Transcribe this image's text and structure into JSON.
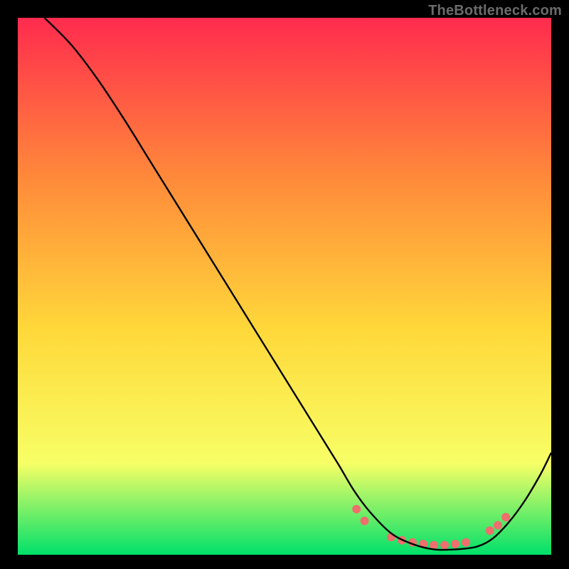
{
  "watermark": "TheBottleneck.com",
  "chart_data": {
    "type": "line",
    "title": "",
    "xlabel": "",
    "ylabel": "",
    "xlim": [
      0,
      100
    ],
    "ylim": [
      0,
      100
    ],
    "background_gradient": {
      "top": "#ff2b4e",
      "upper_mid": "#ff8a3a",
      "mid": "#ffd83a",
      "lower_mid": "#f7ff66",
      "bottom": "#00e06a"
    },
    "series": [
      {
        "name": "bottleneck-curve",
        "color": "#000000",
        "x": [
          5,
          10,
          15,
          20,
          25,
          30,
          35,
          40,
          45,
          50,
          55,
          60,
          63,
          66,
          70,
          74,
          78,
          82,
          86,
          89,
          92,
          95,
          98,
          100
        ],
        "y": [
          100,
          95,
          88.5,
          81,
          73,
          65,
          57,
          49,
          41,
          33,
          25,
          17,
          12,
          8,
          4,
          2,
          1,
          1,
          1.5,
          3,
          6,
          10,
          15,
          19
        ]
      }
    ],
    "markers": {
      "name": "highlight-dots",
      "color": "#ef6e6e",
      "radius": 6,
      "x": [
        63.5,
        65,
        70,
        72,
        74,
        76,
        78,
        80,
        82,
        84,
        88.5,
        90,
        91.5
      ],
      "y": [
        8.5,
        6.3,
        3.3,
        2.7,
        2.3,
        2.0,
        1.8,
        1.8,
        2.0,
        2.3,
        4.5,
        5.5,
        7.0
      ]
    }
  }
}
